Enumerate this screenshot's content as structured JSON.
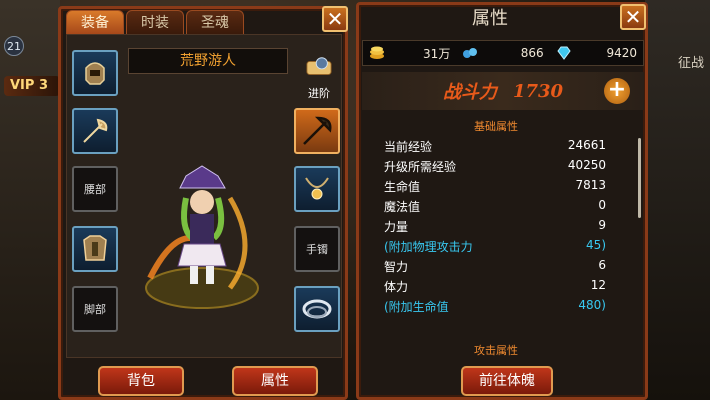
{
  "hud": {
    "level": "21",
    "vip": "VIP 3",
    "side_label": "征战"
  },
  "left_panel": {
    "tabs": [
      {
        "label": "装备"
      },
      {
        "label": "时装"
      },
      {
        "label": "圣魂"
      }
    ],
    "active_tab": 0,
    "character_name": "荒野游人",
    "advance_label": "进阶",
    "empty_slots": {
      "waist": "腰部",
      "feet": "脚部",
      "bracelet": "手镯"
    },
    "buttons": {
      "bag": "背包",
      "attributes": "属性"
    }
  },
  "right_panel": {
    "title": "属性",
    "resources": [
      {
        "icon": "gold-coin-icon",
        "value": "31万"
      },
      {
        "icon": "blue-gem-icon",
        "value": "866"
      },
      {
        "icon": "diamond-icon",
        "value": "9420"
      }
    ],
    "combat_label": "战斗力",
    "combat_value": "1730",
    "basic_section": "基础属性",
    "stats": [
      {
        "label": "当前经验",
        "value": "24661"
      },
      {
        "label": "升级所需经验",
        "value": "40250"
      },
      {
        "label": "生命值",
        "value": "7813"
      },
      {
        "label": "魔法值",
        "value": "0"
      },
      {
        "label": "力量",
        "value": "9"
      },
      {
        "label": "(附加物理攻击力",
        "value": "45)"
      },
      {
        "label": "智力",
        "value": "6"
      },
      {
        "label": "体力",
        "value": "12"
      },
      {
        "label": "(附加生命值",
        "value": "480)"
      }
    ],
    "attack_section": "攻击属性",
    "body_button": "前往体魄"
  },
  "colors": {
    "frame": "#8a3a18",
    "accent_orange": "#f08a30",
    "stat_blue": "#38c8f0",
    "combat_red": "#e85a1a"
  }
}
